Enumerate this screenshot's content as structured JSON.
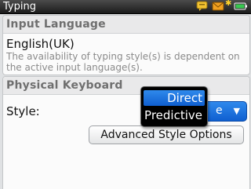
{
  "title_bar": {
    "title": "Typing"
  },
  "status_icons": [
    "chat-icon",
    "message-icon",
    "star-icon",
    "battery-icon"
  ],
  "input_language": {
    "header": "Input Language",
    "value": "English(UK)",
    "note": "The availability of typing style(s) is dependent on the active input language(s)."
  },
  "physical_keyboard": {
    "header": "Physical Keyboard",
    "style_label": "Style:",
    "style_value_visible": "e",
    "advanced_button": "Advanced Style Options"
  },
  "style_dropdown": {
    "options": [
      "Direct",
      "Predictive"
    ],
    "highlighted": "Direct"
  },
  "colors": {
    "accent": "#1e74e0",
    "title_bar": "#2a2a2a",
    "section_header_text": "#6f6f6f",
    "note_text": "#8a8a8a"
  }
}
